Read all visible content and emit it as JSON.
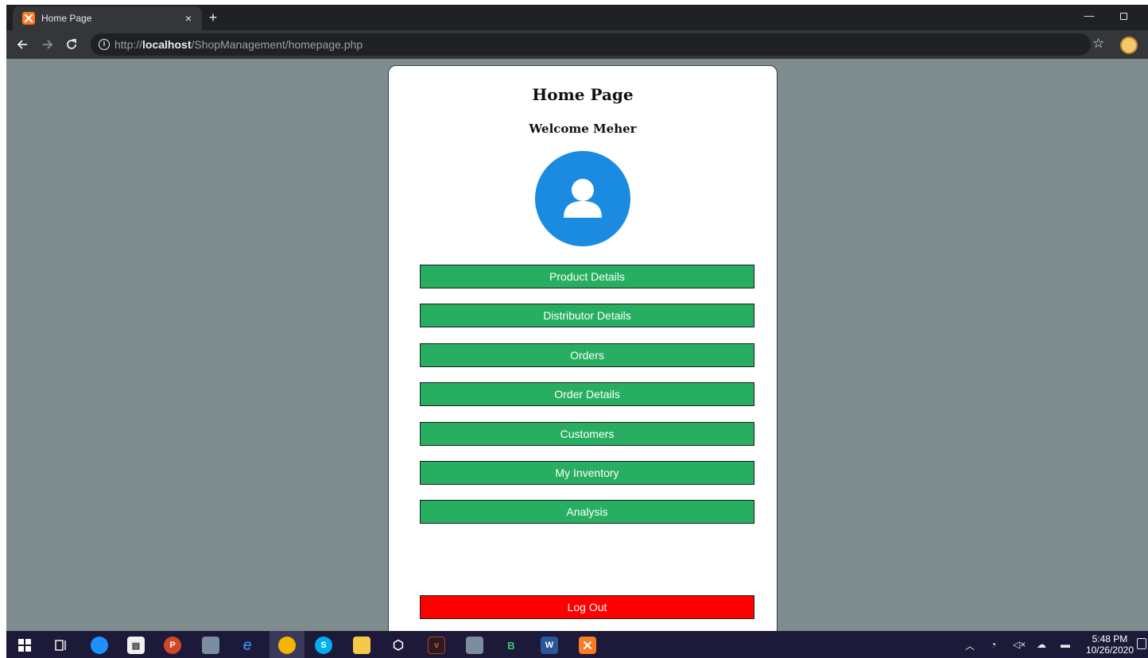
{
  "browser": {
    "tab_title": "Home Page",
    "tab_favicon": "xampp-icon",
    "close_symbol": "×",
    "new_tab_symbol": "+",
    "minimize_symbol": "—",
    "url_scheme": "http://",
    "url_host": "localhost",
    "url_path": "/ShopManagement/homepage.php"
  },
  "page": {
    "title": "Home Page",
    "welcome": "Welcome Meher",
    "avatar_icon": "user-avatar-icon",
    "menu": [
      {
        "label": "Product Details"
      },
      {
        "label": "Distributor Details"
      },
      {
        "label": "Orders"
      },
      {
        "label": "Order Details"
      },
      {
        "label": "Customers"
      },
      {
        "label": "My Inventory"
      },
      {
        "label": "Analysis"
      }
    ],
    "logout": "Log Out"
  },
  "colors": {
    "background": "#7f8c8d",
    "menu_button": "#27ae60",
    "logout_button": "#ff0000",
    "avatar": "#1a8be0"
  },
  "taskbar": {
    "time": "5:48 PM",
    "date": "10/26/2020"
  }
}
